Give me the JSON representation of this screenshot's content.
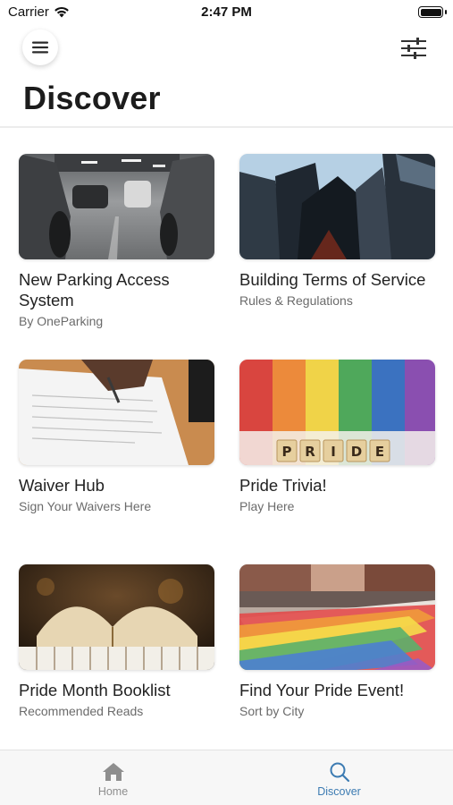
{
  "status_bar": {
    "carrier": "Carrier",
    "time": "2:47 PM",
    "battery_level": 1.0
  },
  "header": {
    "title": "Discover",
    "menu_icon": "hamburger-menu-icon",
    "filter_icon": "sliders-icon"
  },
  "cards": [
    {
      "title": "New Parking Access System",
      "subtitle": "By OneParking",
      "image": "parking-garage-photo"
    },
    {
      "title": "Building Terms of Service",
      "subtitle": "Rules & Regulations",
      "image": "skyscrapers-photo"
    },
    {
      "title": "Waiver Hub",
      "subtitle": "Sign Your Waivers Here",
      "image": "signing-document-photo"
    },
    {
      "title": "Pride Trivia!",
      "subtitle": "Play Here",
      "image": "pride-tiles-photo"
    },
    {
      "title": "Pride Month Booklist",
      "subtitle": "Recommended Reads",
      "image": "open-book-photo"
    },
    {
      "title": "Find Your Pride Event!",
      "subtitle": "Sort by City",
      "image": "pride-parade-photo"
    }
  ],
  "pride_tiles": [
    "P",
    "R",
    "I",
    "D",
    "E"
  ],
  "tab_bar": {
    "tabs": [
      {
        "label": "Home",
        "icon": "home-icon",
        "active": false
      },
      {
        "label": "Discover",
        "icon": "search-icon",
        "active": true
      }
    ],
    "active_color": "#3c7bb2",
    "inactive_color": "#8e8e8e"
  }
}
